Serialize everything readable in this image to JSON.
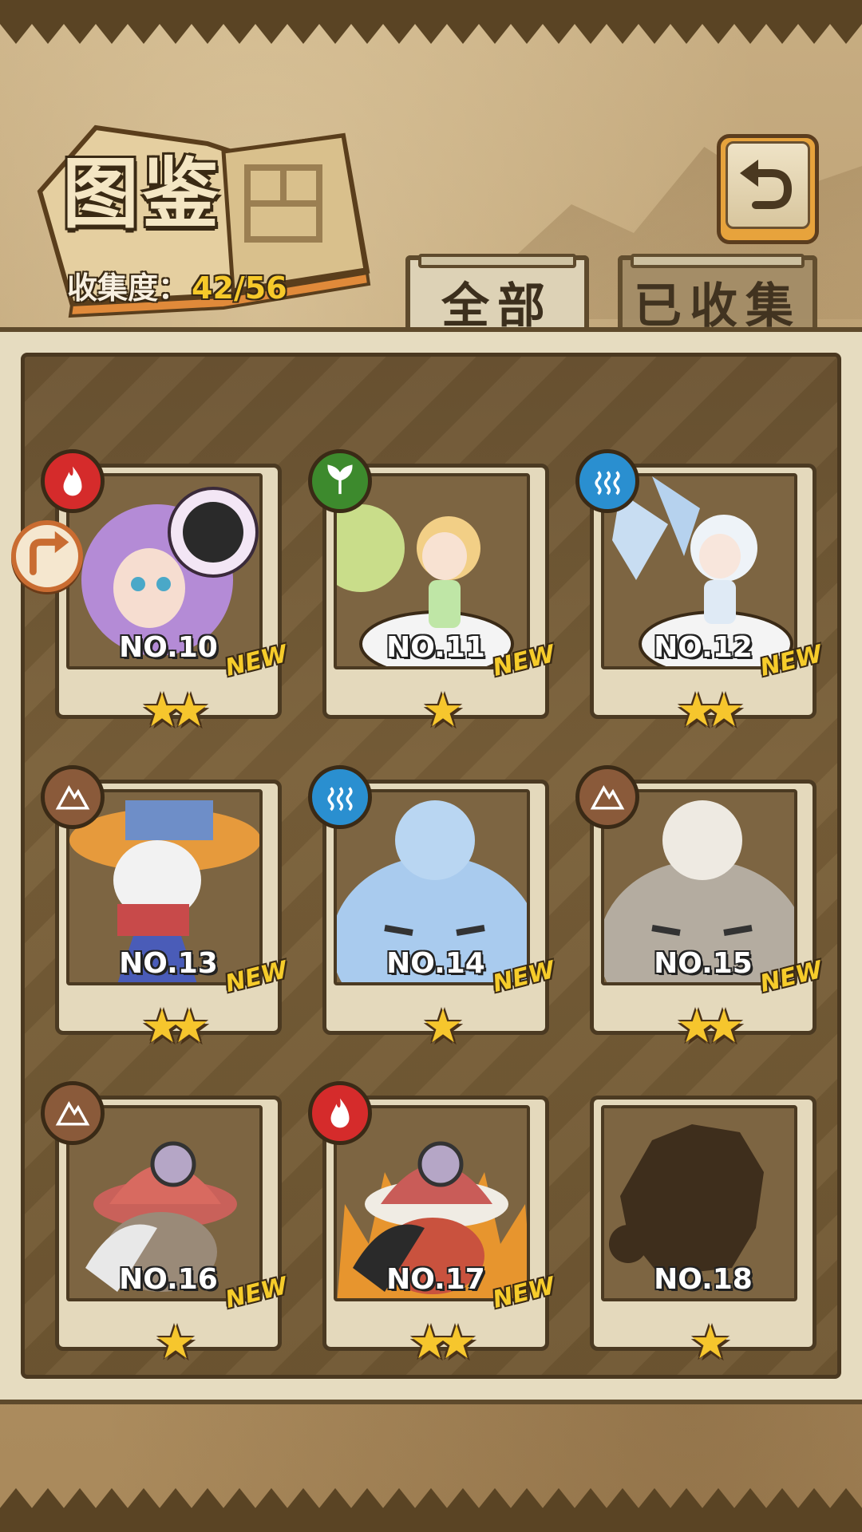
{
  "header": {
    "title": "图鉴",
    "collection_label": "收集度：",
    "collection_value": "42/56",
    "back_icon": "return-arrow-icon"
  },
  "tabs": [
    {
      "label": "全部",
      "active": true
    },
    {
      "label": "已收集",
      "active": false
    }
  ],
  "side_button_icon": "arrow-turn-icon",
  "colors": {
    "fire": "#d52b2b",
    "plant": "#3d8a2d",
    "water": "#2a8fd0",
    "earth": "#8a5a3a",
    "star": "#f6c62d",
    "new_badge": "#f6cc2b"
  },
  "cards": [
    {
      "number": "NO.10",
      "element": "fire",
      "stars": "★★",
      "new": "NEW"
    },
    {
      "number": "NO.11",
      "element": "plant",
      "stars": "★",
      "new": "NEW"
    },
    {
      "number": "NO.12",
      "element": "water",
      "stars": "★★",
      "new": "NEW"
    },
    {
      "number": "NO.13",
      "element": "earth",
      "stars": "★★",
      "new": "NEW"
    },
    {
      "number": "NO.14",
      "element": "water",
      "stars": "★",
      "new": "NEW"
    },
    {
      "number": "NO.15",
      "element": "earth",
      "stars": "★★",
      "new": "NEW"
    },
    {
      "number": "NO.16",
      "element": "earth",
      "stars": "★",
      "new": "NEW"
    },
    {
      "number": "NO.17",
      "element": "fire",
      "stars": "★★",
      "new": "NEW"
    },
    {
      "number": "NO.18",
      "element": "",
      "stars": "★",
      "new": ""
    }
  ]
}
